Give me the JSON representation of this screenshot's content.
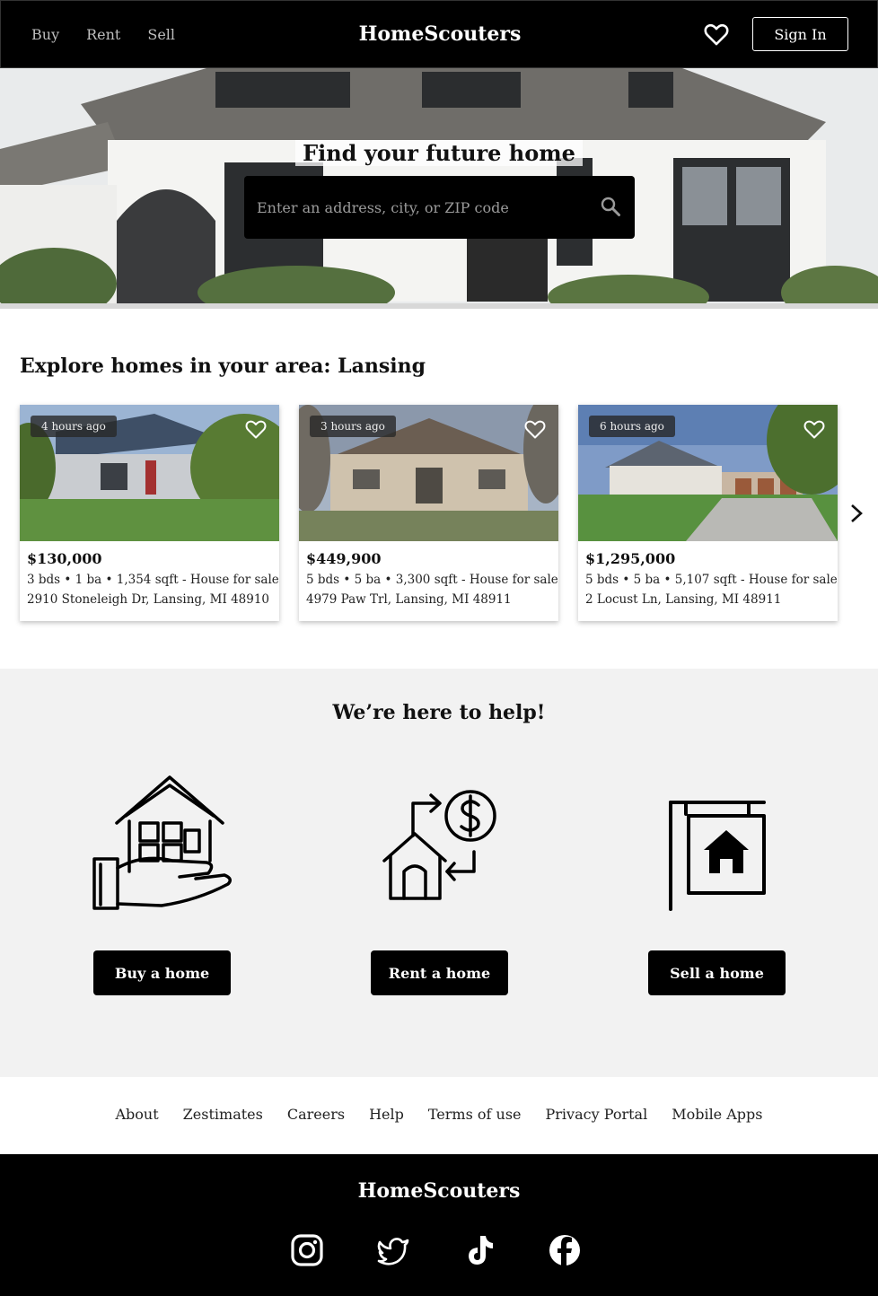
{
  "header": {
    "nav": [
      "Buy",
      "Rent",
      "Sell"
    ],
    "brand": "HomeScouters",
    "favorites_icon": "heart-icon",
    "sign_in": "Sign In"
  },
  "hero": {
    "title": "Find your future home",
    "search_placeholder": "Enter an address, city, or ZIP code",
    "search_icon": "search-icon"
  },
  "explore": {
    "title": "Explore homes in your area: Lansing",
    "listings": [
      {
        "age": "4 hours ago",
        "price": "$130,000",
        "meta": "3 bds • 1 ba • 1,354 sqft - House for sale",
        "address": "2910 Stoneleigh Dr, Lansing, MI 48910"
      },
      {
        "age": "3 hours ago",
        "price": "$449,900",
        "meta": "5 bds • 5 ba • 3,300 sqft - House for sale",
        "address": "4979 Paw Trl, Lansing, MI 48911"
      },
      {
        "age": "6 hours ago",
        "price": "$1,295,000",
        "meta": "5 bds • 5 ba • 5,107 sqft - House for sale",
        "address": "2 Locust Ln, Lansing, MI 48911"
      }
    ],
    "next_icon": "chevron-right-icon"
  },
  "help": {
    "title": "We’re here to help!",
    "options": [
      {
        "label": "Buy a home",
        "icon": "house-in-hand-icon"
      },
      {
        "label": "Rent a home",
        "icon": "house-money-exchange-icon"
      },
      {
        "label": "Sell a home",
        "icon": "for-sale-sign-icon"
      }
    ]
  },
  "footer_links": [
    "About",
    "Zestimates",
    "Careers",
    "Help",
    "Terms of use",
    "Privacy Portal",
    "Mobile Apps"
  ],
  "footer": {
    "brand": "HomeScouters",
    "social": [
      "instagram-icon",
      "twitter-icon",
      "tiktok-icon",
      "facebook-icon"
    ]
  }
}
